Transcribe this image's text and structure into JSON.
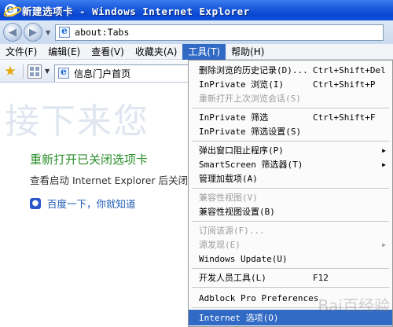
{
  "window": {
    "title": "新建选项卡 - Windows Internet Explorer"
  },
  "address": {
    "url": "about:Tabs"
  },
  "menubar": {
    "items": [
      "文件(F)",
      "编辑(E)",
      "查看(V)",
      "收藏夹(A)",
      "工具(T)",
      "帮助(H)"
    ]
  },
  "favbar": {
    "tab_label": "信息门户首页"
  },
  "content": {
    "big_text": "接下来您",
    "reopen_heading": "重新打开已关闭选项卡",
    "subtext": "查看启动 Internet Explorer 后关闭的",
    "baidu_link": "百度一下，你就知道"
  },
  "tools_menu": {
    "items": [
      {
        "label": "删除浏览的历史记录(D)...",
        "shortcut": "Ctrl+Shift+Del"
      },
      {
        "label": "InPrivate 浏览(I)",
        "shortcut": "Ctrl+Shift+P"
      },
      {
        "label": "重新打开上次浏览会话(S)",
        "shortcut": ""
      },
      {
        "label": "InPrivate 筛选",
        "shortcut": "Ctrl+Shift+F"
      },
      {
        "label": "InPrivate 筛选设置(S)",
        "shortcut": ""
      },
      {
        "label": "弹出窗口阻止程序(P)",
        "shortcut": ""
      },
      {
        "label": "SmartScreen 筛选器(T)",
        "shortcut": ""
      },
      {
        "label": "管理加载项(A)",
        "shortcut": ""
      },
      {
        "label": "兼容性视图(V)",
        "shortcut": ""
      },
      {
        "label": "兼容性视图设置(B)",
        "shortcut": ""
      },
      {
        "label": "订阅该源(F)...",
        "shortcut": ""
      },
      {
        "label": "源发现(E)",
        "shortcut": ""
      },
      {
        "label": "Windows Update(U)",
        "shortcut": ""
      },
      {
        "label": "开发人员工具(L)",
        "shortcut": "F12"
      },
      {
        "label": "Adblock Pro Preferences",
        "shortcut": ""
      },
      {
        "label": "Internet 选项(O)",
        "shortcut": ""
      }
    ]
  },
  "watermark": {
    "text": "Bai百经验"
  },
  "colors": {
    "accent": "#316ac5",
    "titlebar": "#0a48d2",
    "link": "#1f5bb5",
    "green_heading": "#2a8f2a"
  }
}
